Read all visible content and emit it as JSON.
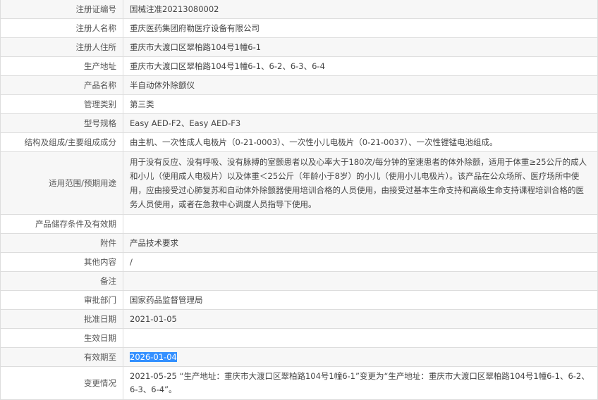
{
  "rows": [
    {
      "label": "注册证编号",
      "value": "国械注准20213080002"
    },
    {
      "label": "注册人名称",
      "value": "重庆医药集团府勒医疗设备有限公司"
    },
    {
      "label": "注册人住所",
      "value": "重庆市大渡口区翠柏路104号1幢6-1"
    },
    {
      "label": "生产地址",
      "value": "重庆市大渡口区翠柏路104号1幢6-1、6-2、6-3、6-4"
    },
    {
      "label": "产品名称",
      "value": "半自动体外除颤仪"
    },
    {
      "label": "管理类别",
      "value": "第三类"
    },
    {
      "label": "型号规格",
      "value": "Easy AED-F2、Easy AED-F3"
    },
    {
      "label": "结构及组成/主要组成成分",
      "value": "由主机、一次性成人电极片（0-21-0003）、一次性小儿电极片（0-21-0037）、一次性锂锰电池组成。"
    },
    {
      "label": "适用范围/预期用途",
      "value": "用于没有反应、没有呼吸、没有脉搏的室颤患者以及心率大于180次/每分钟的室速患者的体外除颤，适用于体重≥25公斤的成人和小儿（使用成人电极片）以及体重＜25公斤（年龄小于8岁）的小儿（使用小儿电极片）。该产品在公众场所、医疗场所中使用，应由接受过心肺复苏和自动体外除颤器使用培训合格的人员使用，由接受过基本生命支持和高级生命支持课程培训合格的医务人员使用，或者在急救中心调度人员指导下使用。"
    },
    {
      "label": "产品储存条件及有效期",
      "value": ""
    },
    {
      "label": "附件",
      "value": "产品技术要求"
    },
    {
      "label": "其他内容",
      "value": "/"
    },
    {
      "label": "备注",
      "value": ""
    },
    {
      "label": "审批部门",
      "value": "国家药品监督管理局"
    },
    {
      "label": "批准日期",
      "value": "2021-01-05"
    },
    {
      "label": "生效日期",
      "value": ""
    },
    {
      "label": "有效期至",
      "value": "2026-01-04"
    },
    {
      "label": "变更情况",
      "value": "2021-05-25 “生产地址：重庆市大渡口区翠柏路104号1幢6-1”变更为“生产地址：重庆市大渡口区翠柏路104号1幢6-1、6-2、6-3、6-4”。"
    }
  ]
}
